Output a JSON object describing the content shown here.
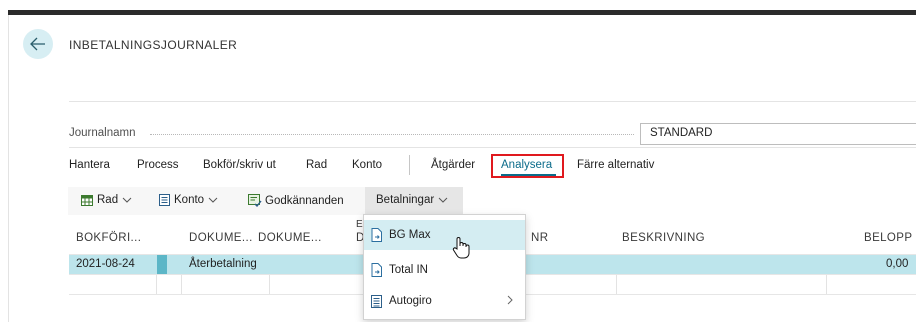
{
  "header": {
    "title": "INBETALNINGSJOURNALER"
  },
  "journal_name": {
    "label": "Journalnamn",
    "value": "STANDARD"
  },
  "nav": {
    "items": [
      "Hantera",
      "Process",
      "Bokför/skriv ut",
      "Rad",
      "Konto"
    ],
    "after_divider": [
      "Åtgärder",
      "Analysera",
      "Färre alternativ"
    ],
    "active": "Analysera"
  },
  "toolbar": {
    "rad": "Rad",
    "konto": "Konto",
    "godkannanden": "Godkännanden",
    "betalningar": "Betalningar"
  },
  "columns": {
    "c1": "BOKFÖRI...",
    "c2": "DOKUME...",
    "c3": "DOKUME...",
    "c4": "D",
    "c4_top": "E",
    "c5": "NR",
    "c6": "BESKRIVNING",
    "c7": "BELOPP"
  },
  "rows": [
    {
      "date": "2021-08-24",
      "doc_type": "Återbetalning",
      "amount": "0,00"
    }
  ],
  "menu": {
    "items": [
      {
        "label": "BG Max",
        "icon": "document-arrow-icon",
        "highlighted": true
      },
      {
        "label": "Total IN",
        "icon": "document-arrow-icon",
        "highlighted": false
      },
      {
        "label": "Autogiro",
        "icon": "list-doc-icon",
        "submenu": true
      }
    ]
  },
  "colors": {
    "accent": "#0b6b8a",
    "selected_row": "#bde5ec",
    "highlight_box": "#e0191e"
  }
}
